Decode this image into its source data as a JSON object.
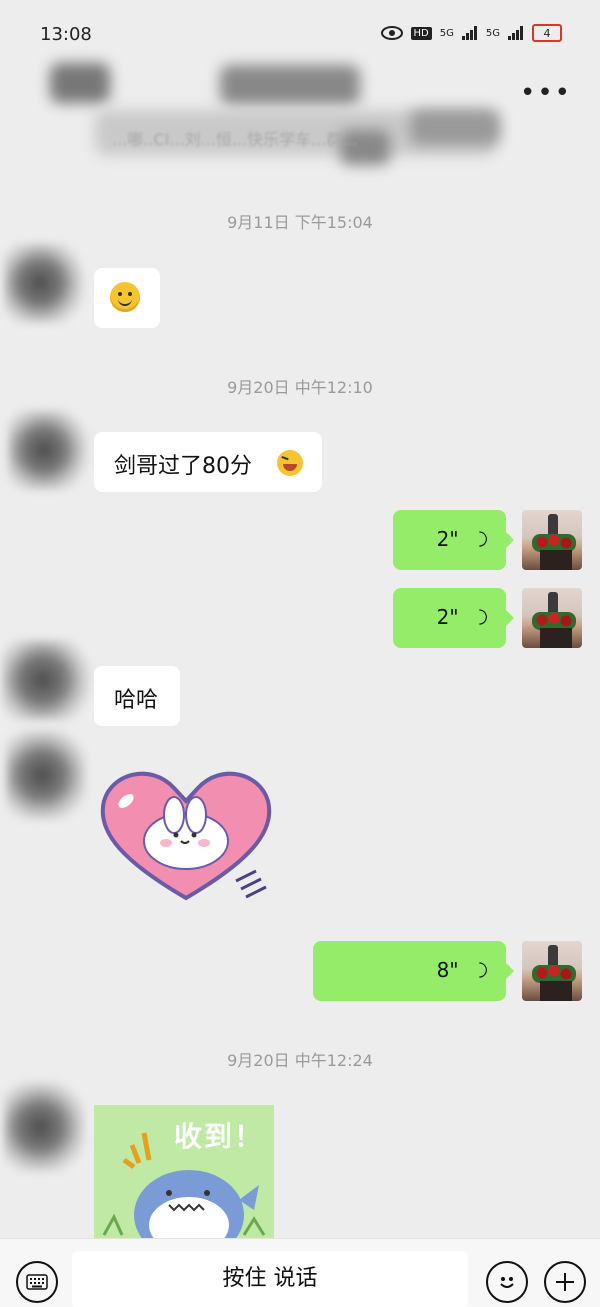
{
  "status_bar": {
    "time": "13:08",
    "network_label": "HD",
    "signal_1": "5G",
    "signal_2": "5G",
    "battery": "4"
  },
  "header": {
    "more_label": "•••",
    "title_blurred": "...哪..CI...刘...恒...快乐学车...群..."
  },
  "messages": [
    {
      "type": "time",
      "text": "9月11日 下午15:04"
    },
    {
      "type": "emoji",
      "side": "left",
      "emoji_name": "smile-icon"
    },
    {
      "type": "time",
      "text": "9月20日 中午12:10"
    },
    {
      "type": "text",
      "side": "left",
      "text": "剑哥过了80分"
    },
    {
      "type": "voice",
      "side": "right",
      "duration": "2\""
    },
    {
      "type": "voice",
      "side": "right",
      "duration": "2\""
    },
    {
      "type": "text",
      "side": "left",
      "text": "哈哈"
    },
    {
      "type": "sticker",
      "side": "left",
      "sticker_name": "heart-bunny-sticker"
    },
    {
      "type": "voice",
      "side": "right",
      "duration": "8\""
    },
    {
      "type": "time",
      "text": "9月20日 中午12:24"
    },
    {
      "type": "sticker",
      "side": "left",
      "sticker_name": "shark-received-sticker",
      "sticker_text": "收到！"
    }
  ],
  "bottom_bar": {
    "hold_to_talk": "按住 说话",
    "keyboard_icon": "keyboard-icon",
    "emoji_icon": "emoji-icon",
    "plus_icon": "plus-icon"
  },
  "colors": {
    "background": "#ededed",
    "bubble_me": "#95ec69",
    "bubble_other": "#ffffff"
  }
}
